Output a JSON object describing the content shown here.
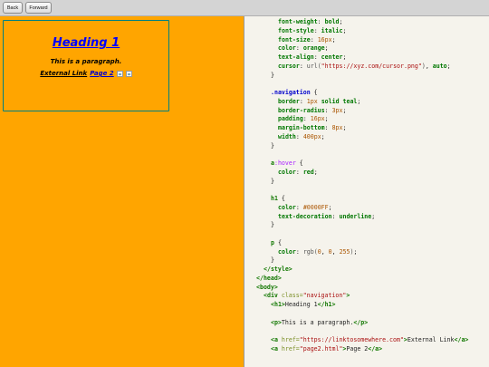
{
  "toolbar": {
    "back_label": "Back",
    "forward_label": "Forward"
  },
  "preview": {
    "heading": "Heading 1",
    "paragraph": "This is a paragraph.",
    "link_external": "External Link",
    "link_page2": "Page 2"
  },
  "code_lines": [
    [
      [
        "p",
        "font-weight"
      ],
      [
        "c",
        ": "
      ],
      [
        "v",
        "bold"
      ],
      [
        "c",
        ";"
      ]
    ],
    [
      [
        "p",
        "font-style"
      ],
      [
        "c",
        ": "
      ],
      [
        "v",
        "italic"
      ],
      [
        "c",
        ";"
      ]
    ],
    [
      [
        "p",
        "font-size"
      ],
      [
        "c",
        ": "
      ],
      [
        "n",
        "16px"
      ],
      [
        "c",
        ";"
      ]
    ],
    [
      [
        "p",
        "color"
      ],
      [
        "c",
        ": "
      ],
      [
        "v",
        "orange"
      ],
      [
        "c",
        ";"
      ]
    ],
    [
      [
        "p",
        "text-align"
      ],
      [
        "c",
        ": "
      ],
      [
        "v",
        "center"
      ],
      [
        "c",
        ";"
      ]
    ],
    [
      [
        "p",
        "cursor"
      ],
      [
        "c",
        ": "
      ],
      [
        "f",
        "url("
      ],
      [
        "s",
        "\"https://xyz.com/cursor.png\""
      ],
      [
        "f",
        ")"
      ],
      [
        "c",
        ", "
      ],
      [
        "v",
        "auto"
      ],
      [
        "c",
        ";"
      ]
    ],
    [
      [
        "c",
        "}"
      ]
    ],
    [],
    [
      [
        "sel",
        ".navigation"
      ],
      [
        "c",
        " {"
      ]
    ],
    [
      [
        "p",
        "border"
      ],
      [
        "c",
        ": "
      ],
      [
        "n",
        "1px"
      ],
      [
        "c",
        " "
      ],
      [
        "v",
        "solid teal"
      ],
      [
        "c",
        ";"
      ]
    ],
    [
      [
        "p",
        "border-radius"
      ],
      [
        "c",
        ": "
      ],
      [
        "n",
        "3px"
      ],
      [
        "c",
        ";"
      ]
    ],
    [
      [
        "p",
        "padding"
      ],
      [
        "c",
        ": "
      ],
      [
        "n",
        "16px"
      ],
      [
        "c",
        ";"
      ]
    ],
    [
      [
        "p",
        "margin-bottom"
      ],
      [
        "c",
        ": "
      ],
      [
        "n",
        "8px"
      ],
      [
        "c",
        ";"
      ]
    ],
    [
      [
        "p",
        "width"
      ],
      [
        "c",
        ": "
      ],
      [
        "n",
        "400px"
      ],
      [
        "c",
        ";"
      ]
    ],
    [
      [
        "c",
        "}"
      ]
    ],
    [],
    [
      [
        "tag",
        "a"
      ],
      [
        "ps",
        ":hover"
      ],
      [
        "c",
        " {"
      ]
    ],
    [
      [
        "p",
        "color"
      ],
      [
        "c",
        ": "
      ],
      [
        "v",
        "red"
      ],
      [
        "c",
        ";"
      ]
    ],
    [
      [
        "c",
        "}"
      ]
    ],
    [],
    [
      [
        "tag",
        "h1"
      ],
      [
        "c",
        " {"
      ]
    ],
    [
      [
        "p",
        "color"
      ],
      [
        "c",
        ": "
      ],
      [
        "n",
        "#0000FF"
      ],
      [
        "c",
        ";"
      ]
    ],
    [
      [
        "p",
        "text-decoration"
      ],
      [
        "c",
        ": "
      ],
      [
        "v",
        "underline"
      ],
      [
        "c",
        ";"
      ]
    ],
    [
      [
        "c",
        "}"
      ]
    ],
    [],
    [
      [
        "tag",
        "p"
      ],
      [
        "c",
        " {"
      ]
    ],
    [
      [
        "p",
        "color"
      ],
      [
        "c",
        ": "
      ],
      [
        "f",
        "rgb("
      ],
      [
        "n",
        "0"
      ],
      [
        "c",
        ", "
      ],
      [
        "n",
        "0"
      ],
      [
        "c",
        ", "
      ],
      [
        "n",
        "255"
      ],
      [
        "f",
        ")"
      ],
      [
        "c",
        ";"
      ]
    ],
    [
      [
        "c",
        "}"
      ]
    ],
    [
      [
        "tag",
        "</style>"
      ]
    ],
    [
      [
        "tag",
        "</head>"
      ]
    ],
    [
      [
        "tag",
        "<body>"
      ]
    ],
    [
      [
        "tag",
        "<div "
      ],
      [
        "at",
        "class="
      ],
      [
        "s",
        "\"navigation\""
      ],
      [
        "tag",
        ">"
      ]
    ],
    [
      [
        "tag",
        "<h1>"
      ],
      [
        "t",
        "Heading 1"
      ],
      [
        "tag",
        "</h1>"
      ]
    ],
    [],
    [
      [
        "tag",
        "<p>"
      ],
      [
        "t",
        "This is a paragraph."
      ],
      [
        "tag",
        "</p>"
      ]
    ],
    [],
    [
      [
        "tag",
        "<a "
      ],
      [
        "at",
        "href="
      ],
      [
        "s",
        "\"https://linktosomewhere.com\""
      ],
      [
        "tag",
        ">"
      ],
      [
        "t",
        "External Link"
      ],
      [
        "tag",
        "</a>"
      ]
    ],
    [
      [
        "tag",
        "<a "
      ],
      [
        "at",
        "href="
      ],
      [
        "s",
        "\"page2.html\""
      ],
      [
        "tag",
        ">"
      ],
      [
        "t",
        "Page 2"
      ],
      [
        "tag",
        "</a>"
      ]
    ]
  ],
  "code_indents": [
    8,
    8,
    8,
    8,
    8,
    8,
    6,
    0,
    6,
    8,
    8,
    8,
    8,
    8,
    6,
    0,
    6,
    8,
    6,
    0,
    6,
    8,
    8,
    6,
    0,
    6,
    8,
    6,
    4,
    2,
    2,
    4,
    6,
    0,
    6,
    0,
    6,
    6
  ]
}
